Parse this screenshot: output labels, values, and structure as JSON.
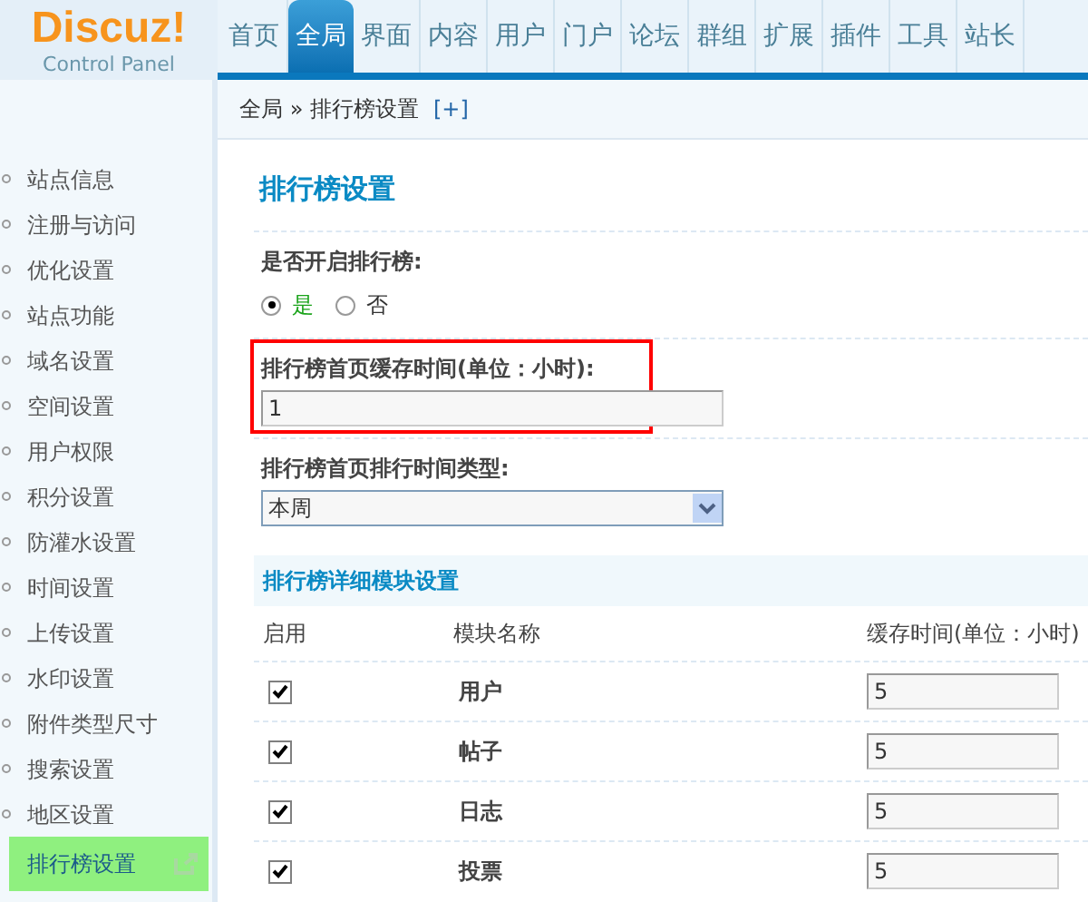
{
  "logo": {
    "name": "Discuz!",
    "subtitle": "Control Panel"
  },
  "nav_tabs": [
    {
      "label": "首页",
      "selected": false
    },
    {
      "label": "全局",
      "selected": true
    },
    {
      "label": "界面",
      "selected": false
    },
    {
      "label": "内容",
      "selected": false
    },
    {
      "label": "用户",
      "selected": false
    },
    {
      "label": "门户",
      "selected": false
    },
    {
      "label": "论坛",
      "selected": false
    },
    {
      "label": "群组",
      "selected": false
    },
    {
      "label": "扩展",
      "selected": false
    },
    {
      "label": "插件",
      "selected": false
    },
    {
      "label": "工具",
      "selected": false
    },
    {
      "label": "站长",
      "selected": false
    }
  ],
  "breadcrumb": {
    "path": "全局 » 排行榜设置",
    "toggle": "[+]"
  },
  "sidebar": {
    "items": [
      {
        "label": "站点信息",
        "selected": false
      },
      {
        "label": "注册与访问",
        "selected": false
      },
      {
        "label": "优化设置",
        "selected": false
      },
      {
        "label": "站点功能",
        "selected": false
      },
      {
        "label": "域名设置",
        "selected": false
      },
      {
        "label": "空间设置",
        "selected": false
      },
      {
        "label": "用户权限",
        "selected": false
      },
      {
        "label": "积分设置",
        "selected": false
      },
      {
        "label": "防灌水设置",
        "selected": false
      },
      {
        "label": "时间设置",
        "selected": false
      },
      {
        "label": "上传设置",
        "selected": false
      },
      {
        "label": "水印设置",
        "selected": false
      },
      {
        "label": "附件类型尺寸",
        "selected": false
      },
      {
        "label": "搜索设置",
        "selected": false
      },
      {
        "label": "地区设置",
        "selected": false
      },
      {
        "label": "排行榜设置",
        "selected": true
      }
    ]
  },
  "page_title": "排行榜设置",
  "settings": [
    {
      "kind": "radio",
      "label": "是否开启排行榜:",
      "options": [
        {
          "label": "是",
          "selected": true
        },
        {
          "label": "否",
          "selected": false
        }
      ]
    },
    {
      "kind": "text",
      "label": "排行榜首页缓存时间(单位：小时):",
      "value": "1",
      "highlighted": true
    },
    {
      "kind": "select",
      "label": "排行榜首页排行时间类型:",
      "value": "本周"
    }
  ],
  "modules_section": {
    "title": "排行榜详细模块设置",
    "columns": [
      "启用",
      "模块名称",
      "缓存时间(单位：小时)"
    ],
    "rows": [
      {
        "enabled": true,
        "name": "用户",
        "cache_time": "5"
      },
      {
        "enabled": true,
        "name": "帖子",
        "cache_time": "5"
      },
      {
        "enabled": true,
        "name": "日志",
        "cache_time": "5"
      },
      {
        "enabled": true,
        "name": "投票",
        "cache_time": "5"
      }
    ]
  }
}
